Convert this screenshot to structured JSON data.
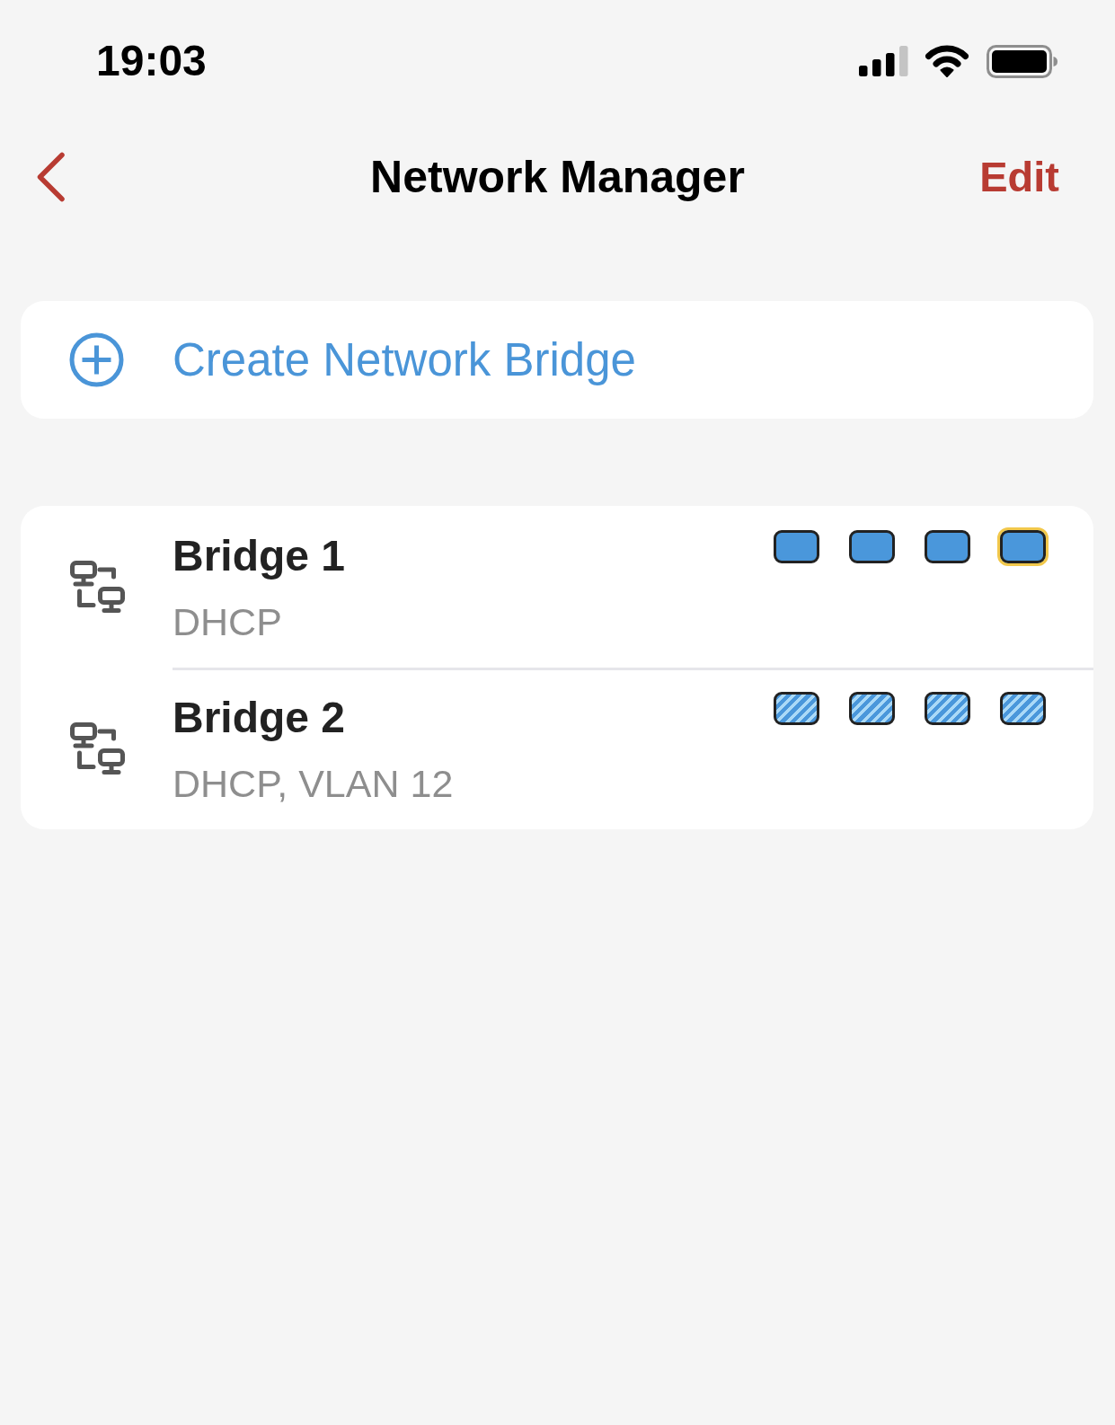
{
  "status_bar": {
    "time": "19:03"
  },
  "nav_bar": {
    "title": "Network Manager",
    "action": "Edit"
  },
  "create_button": {
    "label": "Create Network Bridge"
  },
  "bridges": [
    {
      "name": "Bridge 1",
      "detail": "DHCP",
      "ports": [
        {
          "kind": "solid",
          "selected": false
        },
        {
          "kind": "solid",
          "selected": false
        },
        {
          "kind": "solid",
          "selected": false
        },
        {
          "kind": "solid",
          "selected": true
        }
      ]
    },
    {
      "name": "Bridge 2",
      "detail": "DHCP, VLAN 12",
      "ports": [
        {
          "kind": "striped",
          "selected": false
        },
        {
          "kind": "striped",
          "selected": false
        },
        {
          "kind": "striped",
          "selected": false
        },
        {
          "kind": "striped",
          "selected": false
        }
      ]
    }
  ]
}
